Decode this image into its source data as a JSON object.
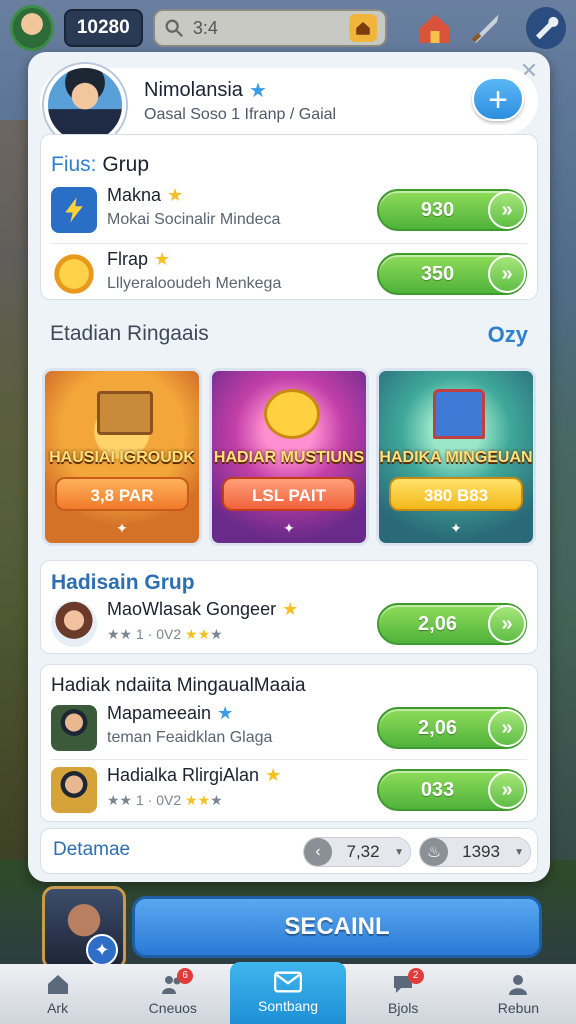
{
  "hud": {
    "coins": "10280",
    "search_text": "3:4"
  },
  "profile": {
    "name": "Nimolansia",
    "subtitle": "Oasal Soso 1 Ifranp / Gaial"
  },
  "group1": {
    "title_accent": "Fius:",
    "title_rest": " Grup",
    "rows": [
      {
        "title": "Makna",
        "subtitle": "Mokai Socinalir Mindeca",
        "value": "930"
      },
      {
        "title": "Flrap",
        "subtitle": "Lllyeralooudeh Menkega",
        "value": "350"
      }
    ]
  },
  "section": {
    "left": "Etadian Ringaais",
    "right": "Ozy"
  },
  "tiles": [
    {
      "label": "HAUSIAI IGROUDK",
      "button": "3,8 PAR"
    },
    {
      "label": "HADIAR MUSTIUNS",
      "button": "LSL PAIT"
    },
    {
      "label": "HADIKA MINGEUAN",
      "button": "380 B83"
    }
  ],
  "group2": {
    "title": "Hadisain Grup",
    "rows": [
      {
        "title": "MaoWlasak Gongeer",
        "stars_text": "1 · 0V2",
        "value": "2,06"
      }
    ]
  },
  "group3": {
    "title": "Hadiak ndaiita MingaualMaaia",
    "rows": [
      {
        "title": "Mapameeain",
        "subtitle": "teman Feaidklan Glaga",
        "value": "2,06"
      },
      {
        "title": "Hadialka RlirgiAlan",
        "stars_text": "1 · 0V2",
        "value": "033"
      }
    ]
  },
  "bottom_strip": {
    "label": "Detamae",
    "pill1": "7,32",
    "pill2": "1393"
  },
  "main_button": "SECAINL",
  "nav": [
    {
      "label": "Ark",
      "icon": "home-icon"
    },
    {
      "label": "Cneuos",
      "icon": "group-icon",
      "badge": "6"
    },
    {
      "label": "Sontbang",
      "icon": "mail-icon"
    },
    {
      "label": "Bjols",
      "icon": "chat-icon",
      "badge": "2"
    },
    {
      "label": "Rebun",
      "icon": "profile-icon"
    }
  ]
}
